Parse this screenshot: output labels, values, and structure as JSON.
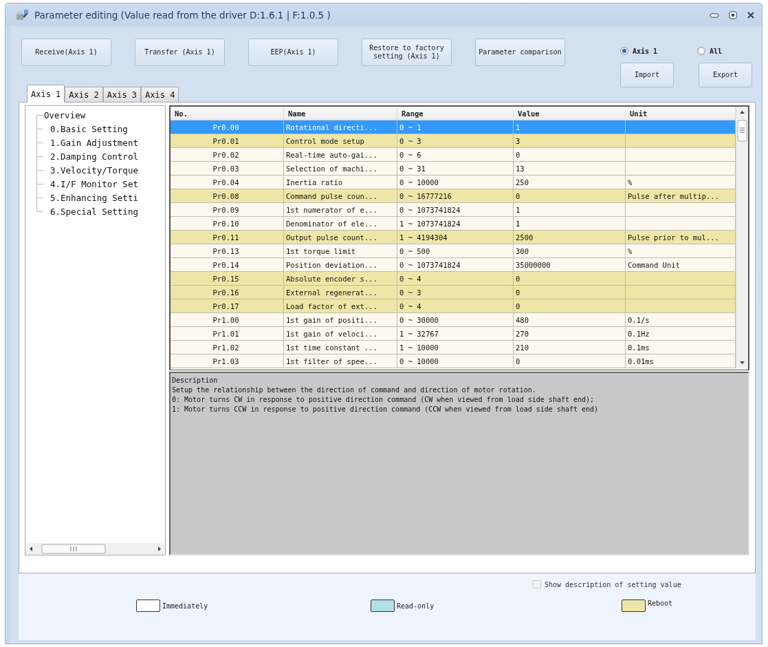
{
  "window": {
    "title": "Parameter editing (Value read from the driver D:1.6.1 | F:1.0.5 )"
  },
  "toolbar": {
    "buttons": [
      "Receive(Axis 1)",
      "Transfer (Axis 1)",
      "EEP(Axis 1)",
      "Restore to factory setting (Axis 1)",
      "Parameter comparison"
    ],
    "scope": [
      {
        "label": "Axis 1",
        "selected": true
      },
      {
        "label": "All",
        "selected": false
      }
    ],
    "io_buttons": [
      "Import",
      "Export"
    ]
  },
  "tabs": [
    {
      "label": "Axis 1",
      "selected": true
    },
    {
      "label": "Axis 2",
      "selected": false
    },
    {
      "label": "Axis 3",
      "selected": false
    },
    {
      "label": "Axis 4",
      "selected": false
    }
  ],
  "tree": {
    "label": "Overview",
    "children": [
      {
        "label": "0.Basic Setting"
      },
      {
        "label": "1.Gain Adjustment"
      },
      {
        "label": "2.Damping Control"
      },
      {
        "label": "3.Velocity/Torque"
      },
      {
        "label": "4.I/F Monitor Set"
      },
      {
        "label": "5.Enhancing Setti"
      },
      {
        "label": "6.Special Setting"
      }
    ]
  },
  "table": {
    "columns": [
      "No.",
      "Name",
      "Range",
      "Value",
      "Unit"
    ],
    "rows": [
      {
        "no": "Pr0.00",
        "name": "Rotational directi...",
        "range": "0 ~ 1",
        "value": "1",
        "unit": "",
        "selected": true
      },
      {
        "no": "Pr0.01",
        "name": "Control mode setup",
        "range": "0 ~ 3",
        "value": "3",
        "unit": "",
        "selected": false,
        "kind": "reboot"
      },
      {
        "no": "Pr0.02",
        "name": "Real-time auto-gai...",
        "range": "0 ~ 6",
        "value": "0",
        "unit": "",
        "selected": false,
        "kind": "immediate"
      },
      {
        "no": "Pr0.03",
        "name": "Selection of machi...",
        "range": "0 ~ 31",
        "value": "13",
        "unit": "",
        "selected": false,
        "kind": "immediate"
      },
      {
        "no": "Pr0.04",
        "name": "Inertia ratio",
        "range": "0 ~ 10000",
        "value": "250",
        "unit": "%",
        "selected": false,
        "kind": "immediate"
      },
      {
        "no": "Pr0.08",
        "name": "Command pulse coun...",
        "range": "0 ~ 16777216",
        "value": "0",
        "unit": "Pulse after multip...",
        "selected": false,
        "kind": "reboot"
      },
      {
        "no": "Pr0.09",
        "name": "1st numerator of e...",
        "range": "0 ~ 1073741824",
        "value": "1",
        "unit": "",
        "selected": false,
        "kind": "immediate"
      },
      {
        "no": "Pr0.10",
        "name": "Denominator of ele...",
        "range": "1 ~ 1073741824",
        "value": "1",
        "unit": "",
        "selected": false,
        "kind": "immediate"
      },
      {
        "no": "Pr0.11",
        "name": "Output pulse count...",
        "range": "1 ~ 4194304",
        "value": "2500",
        "unit": "Pulse prior to mul...",
        "selected": false,
        "kind": "reboot"
      },
      {
        "no": "Pr0.13",
        "name": "1st torque limit",
        "range": "0 ~ 500",
        "value": "300",
        "unit": "%",
        "selected": false,
        "kind": "immediate"
      },
      {
        "no": "Pr0.14",
        "name": "Position deviation...",
        "range": "0 ~ 1073741824",
        "value": "35000000",
        "unit": "Command Unit",
        "selected": false,
        "kind": "immediate"
      },
      {
        "no": "Pr0.15",
        "name": "Absolute encoder s...",
        "range": "0 ~ 4",
        "value": "0",
        "unit": "",
        "selected": false,
        "kind": "reboot"
      },
      {
        "no": "Pr0.16",
        "name": "External regenerat...",
        "range": "0 ~ 3",
        "value": "0",
        "unit": "",
        "selected": false,
        "kind": "reboot"
      },
      {
        "no": "Pr0.17",
        "name": "Load factor of ext...",
        "range": "0 ~ 4",
        "value": "0",
        "unit": "",
        "selected": false,
        "kind": "reboot"
      },
      {
        "no": "Pr1.00",
        "name": "1st gain of positi...",
        "range": "0 ~ 30000",
        "value": "480",
        "unit": "0.1/s",
        "selected": false,
        "kind": "immediate"
      },
      {
        "no": "Pr1.01",
        "name": "1st gain of veloci...",
        "range": "1 ~ 32767",
        "value": "270",
        "unit": "0.1Hz",
        "selected": false,
        "kind": "immediate"
      },
      {
        "no": "Pr1.02",
        "name": "1st time constant ...",
        "range": "1 ~ 10000",
        "value": "210",
        "unit": "0.1ms",
        "selected": false,
        "kind": "immediate"
      },
      {
        "no": "Pr1.03",
        "name": "1st filter of spee...",
        "range": "0 ~ 10000",
        "value": "0",
        "unit": "0.01ms",
        "selected": false,
        "kind": "immediate"
      }
    ]
  },
  "description": {
    "heading": "Description",
    "lines": [
      "Setup the relationship between the direction of command and direction of motor rotation.",
      "0: Motor turns CW in response to positive direction command (CW when viewed from load side shaft end);",
      "1: Motor turns CCW in response to positive direction command (CCW when viewed from load side shaft end)"
    ]
  },
  "show_description": {
    "label": "Show description of setting value",
    "checked": false,
    "disabled": true
  },
  "legend": [
    {
      "label": "Immediately",
      "color": "#ffffff"
    },
    {
      "label": "Read-only",
      "color": "#b0e0e6"
    },
    {
      "label": "Reboot",
      "color": "#eee6a6"
    }
  ]
}
